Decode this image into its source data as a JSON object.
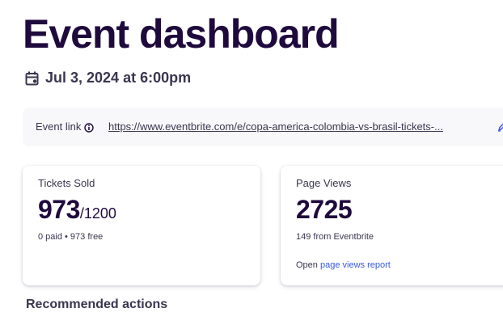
{
  "header": {
    "title": "Event dashboard",
    "date_icon": "calendar-icon",
    "date_text": "Jul 3, 2024 at 6:00pm"
  },
  "event_link": {
    "label": "Event link",
    "info_icon": "info-icon",
    "url": "https://www.eventbrite.com/e/copa-america-colombia-vs-brasil-tickets-...",
    "edit_icon": "pencil-icon"
  },
  "tickets_card": {
    "label": "Tickets Sold",
    "sold": "973",
    "total": "/1200",
    "breakdown": "0 paid • 973 free"
  },
  "views_card": {
    "label": "Page Views",
    "views": "2725",
    "source": "149 from Eventbrite",
    "open_prefix": "Open",
    "report_link": "page views report"
  },
  "recommended": {
    "heading": "Recommended actions"
  },
  "colors": {
    "title": "#1e0a3c",
    "text": "#39364f",
    "link": "#3659e3",
    "link_bar_bg": "#f8f7fa"
  }
}
